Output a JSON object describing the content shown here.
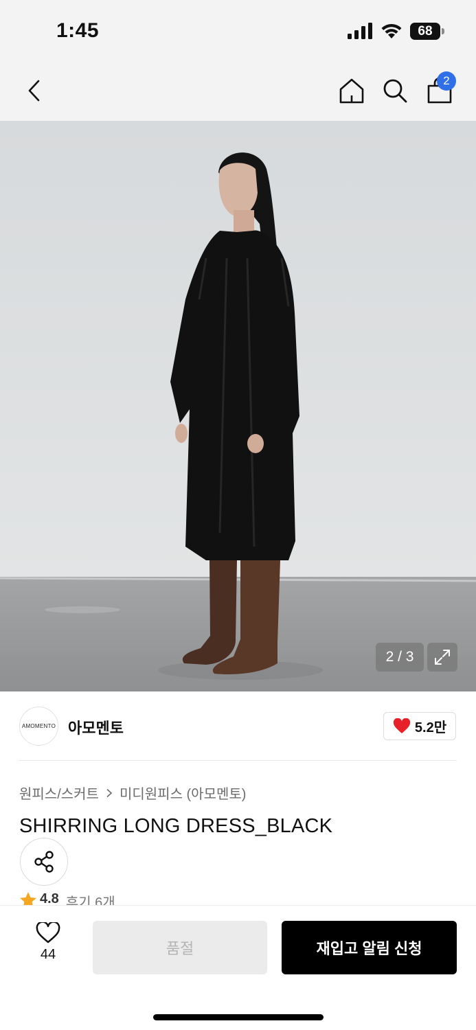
{
  "status_bar": {
    "time": "1:45",
    "battery": "68",
    "icons": [
      "signal-icon",
      "wifi-icon",
      "battery-icon"
    ]
  },
  "nav": {
    "icons": [
      "chevron-left-icon",
      "home-icon",
      "search-icon",
      "shopping-bag-icon"
    ],
    "cart_count": "2"
  },
  "gallery": {
    "counter": "2 / 3",
    "current_index": 2,
    "total": 3,
    "expand_icon": "expand-icon"
  },
  "brand": {
    "logo_text": "AMOMENTO",
    "name": "아모멘토",
    "likes": "5.2만",
    "like_icon": "heart-filled-icon"
  },
  "breadcrumb": {
    "category": "원피스/스커트",
    "subcategory": "미디원피스 (아모멘토)"
  },
  "product": {
    "title": "SHIRRING LONG DRESS_BLACK",
    "rating": "4.8",
    "reviews": "후기 6개"
  },
  "bottom_bar": {
    "wish_count": "44",
    "soldout_label": "품절",
    "restock_label": "재입고 알림 신청"
  },
  "colors": {
    "accent_blue": "#2f6fe8",
    "heart_red": "#e8202a",
    "star_orange": "#f5a623",
    "primary_black": "#000000"
  }
}
